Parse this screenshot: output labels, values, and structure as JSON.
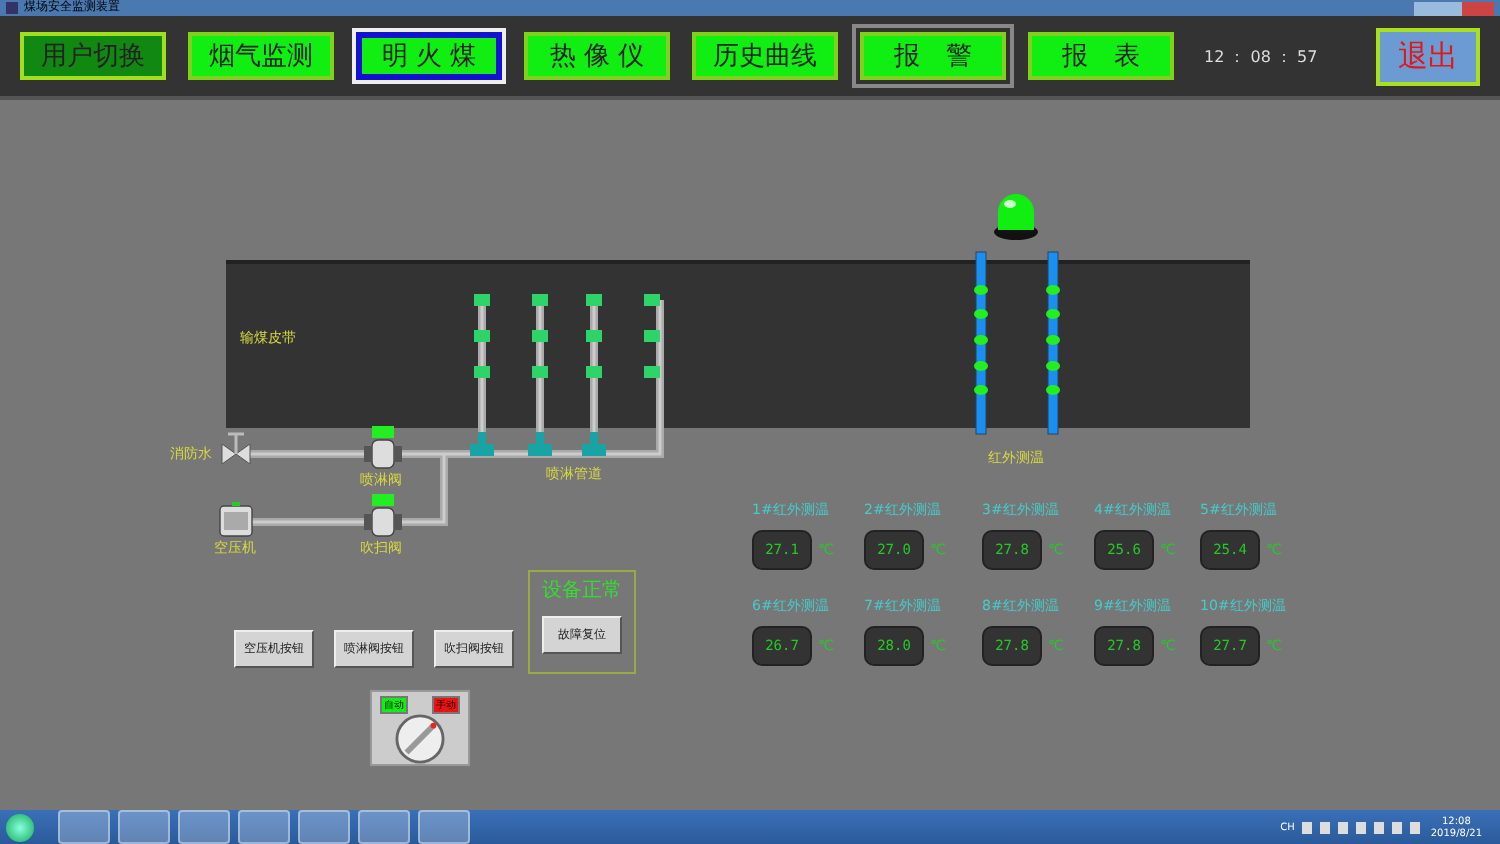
{
  "window": {
    "title": "煤场安全监测装置"
  },
  "nav": [
    {
      "label": "用户切换",
      "selected": false,
      "kind": "dark"
    },
    {
      "label": "烟气监测",
      "selected": false,
      "kind": "plain"
    },
    {
      "label": "明 火 煤",
      "selected": true,
      "kind": "plain"
    },
    {
      "label": "热 像 仪",
      "selected": false,
      "kind": "plain"
    },
    {
      "label": "历史曲线",
      "selected": false,
      "kind": "plain"
    },
    {
      "label": "报　警",
      "selected": false,
      "kind": "framed"
    },
    {
      "label": "报　表",
      "selected": false,
      "kind": "plain"
    }
  ],
  "clock": "12 ： 08 ： 57",
  "exit_button": "退出",
  "diagram": {
    "conveyor_label": "输煤皮带",
    "fire_water": "消防水",
    "spray_valve": "喷淋阀",
    "purge_valve": "吹扫阀",
    "compressor": "空压机",
    "spray_pipe": "喷淋管道",
    "ir_label": "红外测温",
    "alarm_lamp_on": true
  },
  "sensors": [
    {
      "label": "1#红外测温",
      "value": "27.1",
      "unit": "℃"
    },
    {
      "label": "2#红外测温",
      "value": "27.0",
      "unit": "℃"
    },
    {
      "label": "3#红外测温",
      "value": "27.8",
      "unit": "℃"
    },
    {
      "label": "4#红外测温",
      "value": "25.6",
      "unit": "℃"
    },
    {
      "label": "5#红外测温",
      "value": "25.4",
      "unit": "℃"
    },
    {
      "label": "6#红外测温",
      "value": "26.7",
      "unit": "℃"
    },
    {
      "label": "7#红外测温",
      "value": "28.0",
      "unit": "℃"
    },
    {
      "label": "8#红外测温",
      "value": "27.8",
      "unit": "℃"
    },
    {
      "label": "9#红外测温",
      "value": "27.8",
      "unit": "℃"
    },
    {
      "label": "10#红外测温",
      "value": "27.7",
      "unit": "℃"
    }
  ],
  "buttons": [
    "空压机按钮",
    "喷淋阀按钮",
    "吹扫阀按钮"
  ],
  "reset_button": "故障复位",
  "status": "设备正常",
  "switch": {
    "auto": "自动",
    "manual": "手动"
  },
  "taskbar": {
    "ime": "CH",
    "time": "12:08",
    "date": "2019/8/21"
  }
}
